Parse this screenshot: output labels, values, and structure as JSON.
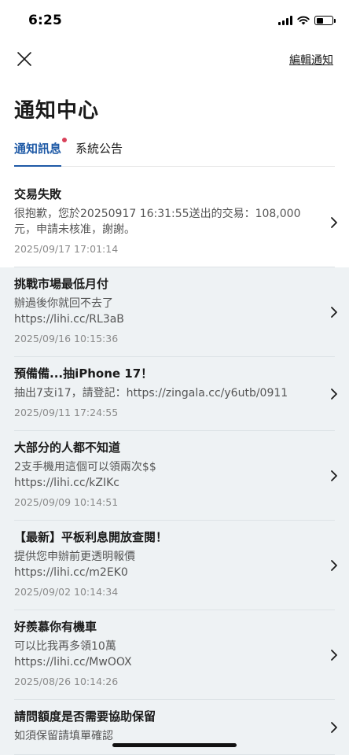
{
  "status": {
    "time": "6:25",
    "battery_level": 0.45
  },
  "header": {
    "edit_label": "編輯通知",
    "title": "通知中心"
  },
  "tabs": [
    {
      "label": "通知訊息",
      "active": true,
      "unread_dot": true
    },
    {
      "label": "系統公告",
      "active": false,
      "unread_dot": false
    }
  ],
  "notifications": [
    {
      "title": "交易失敗",
      "body": "很抱歉，您於20250917 16:31:55送出的交易：108,000元，申請未核准，謝謝。",
      "time": "2025/09/17 17:01:14",
      "read": false
    },
    {
      "title": "挑戰市場最低月付",
      "body": "辦過後你就回不去了\nhttps://lihi.cc/RL3aB",
      "time": "2025/09/16 10:15:36",
      "read": true
    },
    {
      "title": "預備備...抽iPhone 17！",
      "body": "抽出7支i17，請登記：https://zingala.cc/y6utb/0911",
      "time": "2025/09/11 17:24:55",
      "read": true
    },
    {
      "title": "大部分的人都不知道",
      "body": "2支手機用這個可以領兩次$$\nhttps://lihi.cc/kZIKc",
      "time": "2025/09/09 10:14:51",
      "read": true
    },
    {
      "title": "【最新】平板利息開放查閱！",
      "body": "提供您申辦前更透明報價\nhttps://lihi.cc/m2EK0",
      "time": "2025/09/02 10:14:34",
      "read": true
    },
    {
      "title": "好羨慕你有機車",
      "body": "可以比我再多領10萬\nhttps://lihi.cc/MwOOX",
      "time": "2025/08/26 10:14:26",
      "read": true
    },
    {
      "title": "請問額度是否需要協助保留",
      "body": "如須保留請填單確認",
      "time": "",
      "read": true
    }
  ]
}
